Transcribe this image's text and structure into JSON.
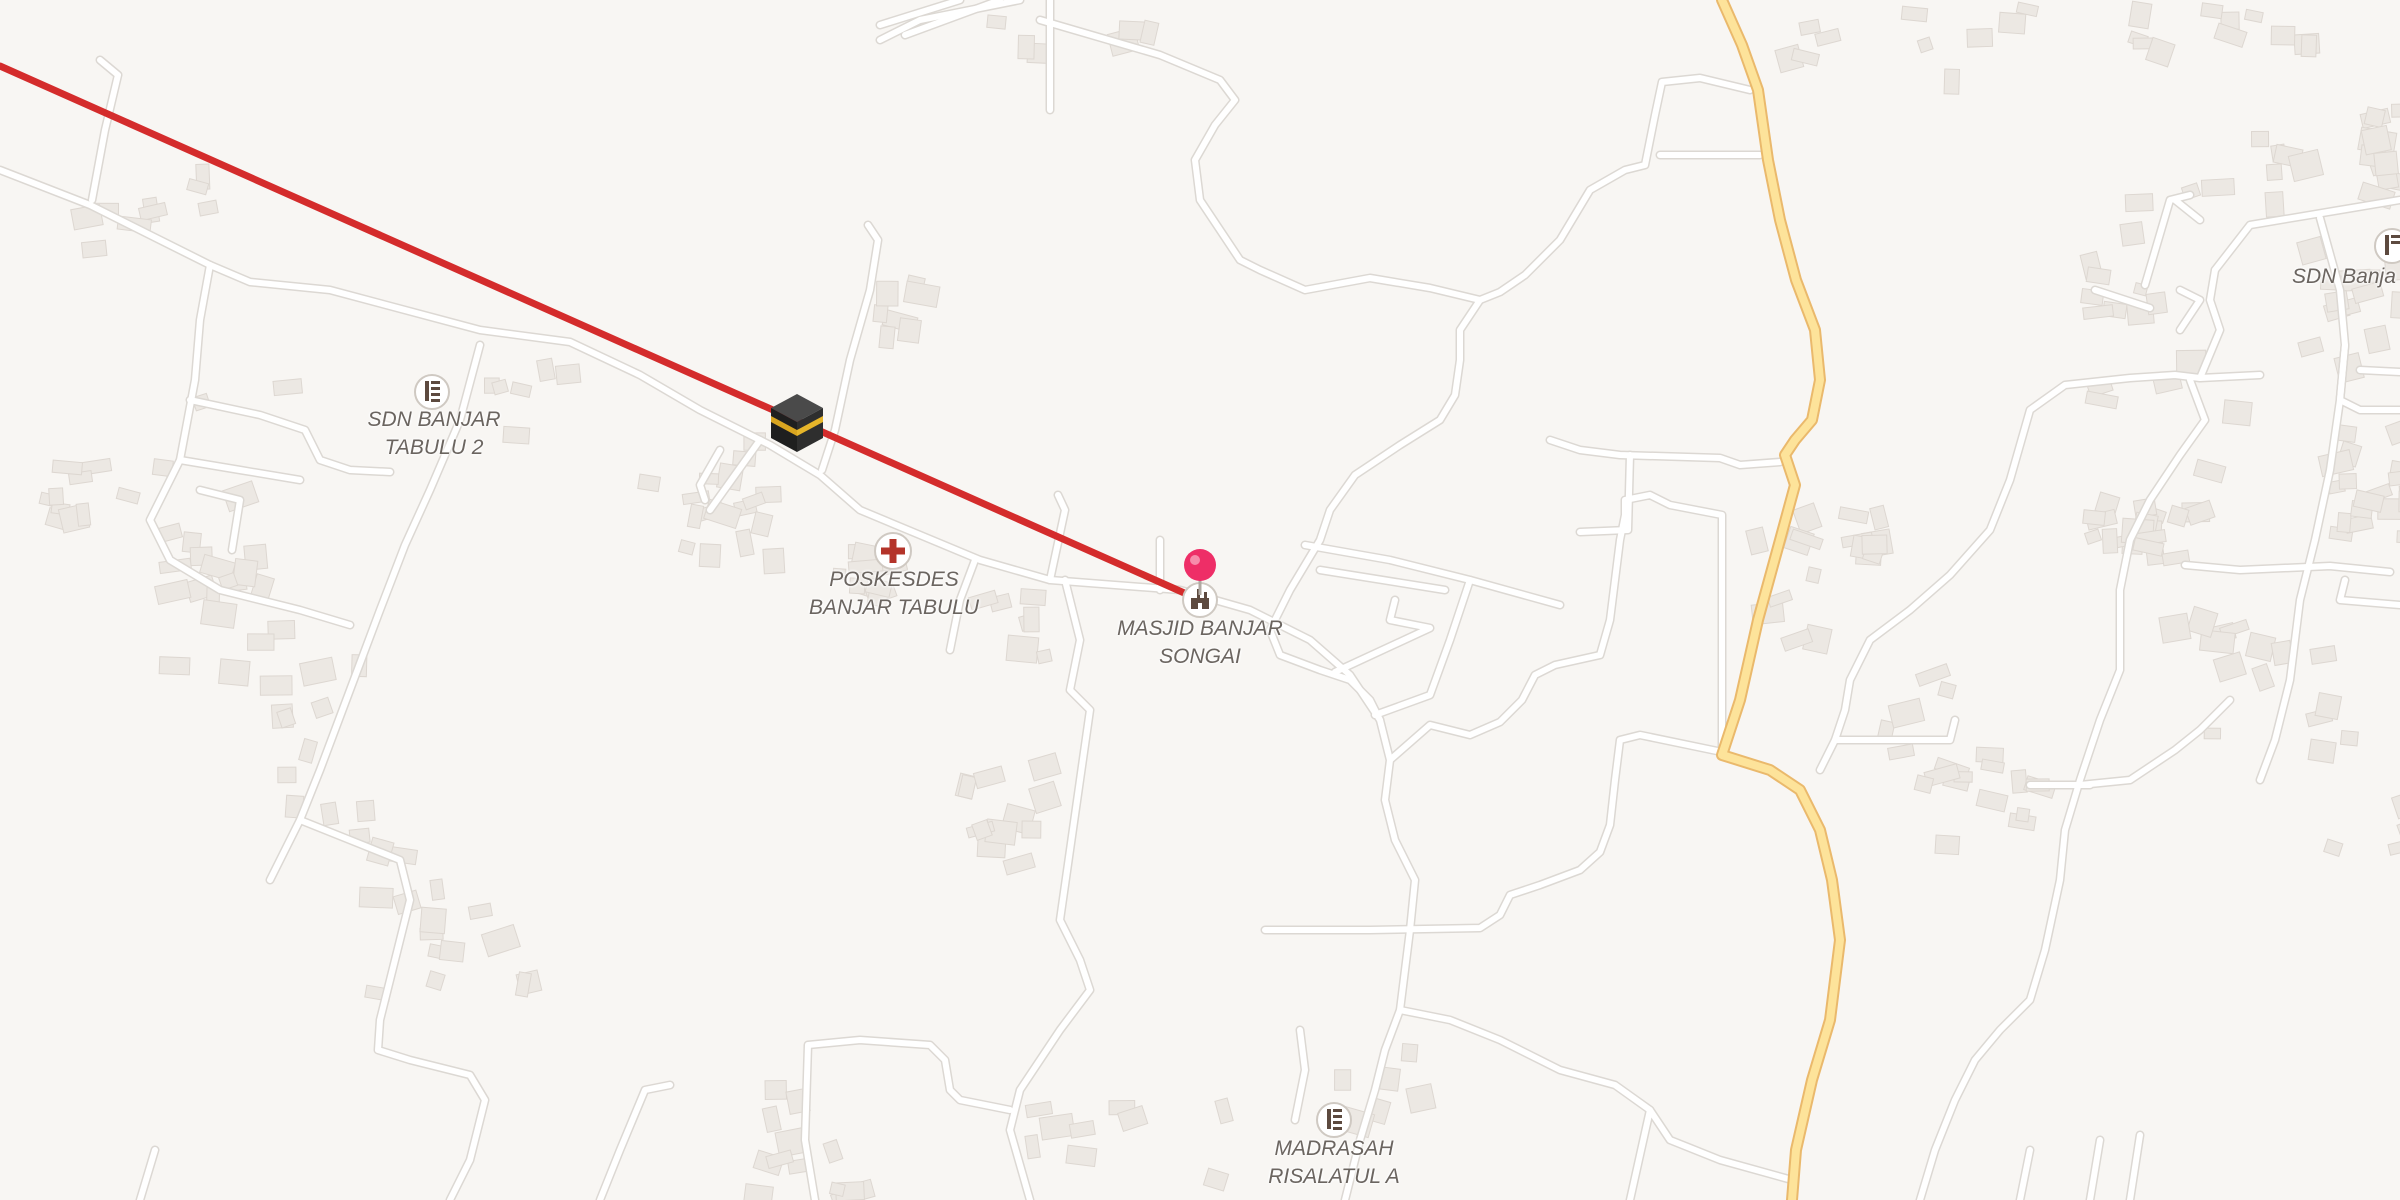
{
  "map": {
    "background_color": "#f8f6f3",
    "road_color": "#ffffff",
    "road_casing_color": "#dcd8d3",
    "main_road_color": "#fde39a",
    "main_road_casing_color": "#eab96c",
    "building_color": "#ece8e3",
    "building_outline_color": "#ddd7d1",
    "qibla_line_color": "#d42c2c",
    "user_location_pin_color": "#ee2e67"
  },
  "markers": {
    "kaaba": {
      "icon": "kaaba-icon"
    },
    "user_location": {
      "icon": "map-pin-icon"
    }
  },
  "pois": [
    {
      "name": "SDN BANJAR\nTABULU 2",
      "icon": "school-icon"
    },
    {
      "name": "POSKESDES\nBANJAR TABULU",
      "icon": "medical-cross-icon"
    },
    {
      "name": "MASJID BANJAR\nSONGAI",
      "icon": "mosque-icon"
    },
    {
      "name": "MADRASAH\nRISALATUL A",
      "icon": "school-icon"
    },
    {
      "name": "SDN Banja",
      "icon": "school-icon"
    }
  ]
}
